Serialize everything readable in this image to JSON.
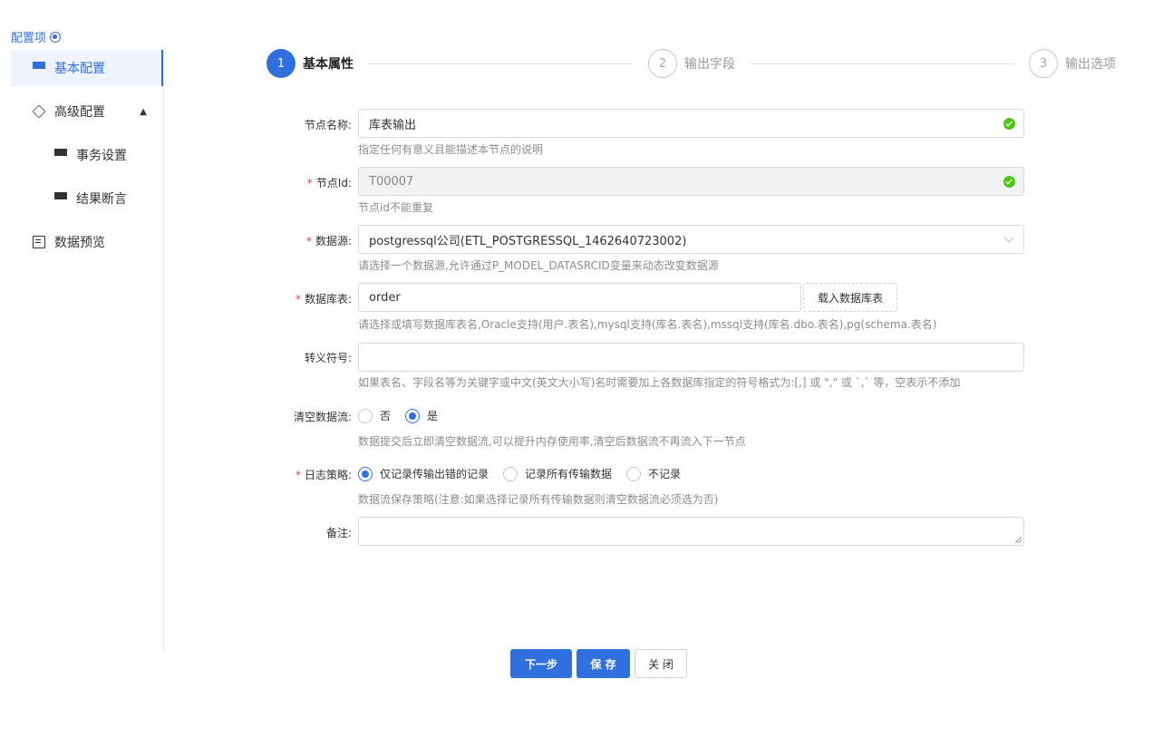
{
  "sidebar": {
    "title": "配置项",
    "items": [
      {
        "label": "基本配置",
        "icon": "grid-icon",
        "active": true
      },
      {
        "label": "高级配置",
        "icon": "cube-icon",
        "expanded": true
      },
      {
        "label": "事务设置",
        "icon": "grid-icon"
      },
      {
        "label": "结果断言",
        "icon": "grid-icon"
      },
      {
        "label": "数据预览",
        "icon": "document-icon"
      }
    ]
  },
  "steps": [
    {
      "number": "1",
      "label": "基本属性",
      "state": "active"
    },
    {
      "number": "2",
      "label": "输出字段",
      "state": "inactive"
    },
    {
      "number": "3",
      "label": "输出选项",
      "state": "inactive"
    }
  ],
  "form": {
    "node_name": {
      "label": "节点名称:",
      "value": "库表输出",
      "help": "指定任何有意义且能描述本节点的说明"
    },
    "node_id": {
      "label": "节点Id:",
      "value": "T00007",
      "help": "节点id不能重复"
    },
    "datasource": {
      "label": "数据源:",
      "value": "postgressql公司(ETL_POSTGRESSQL_1462640723002)",
      "help": "请选择一个数据源,允许通过P_MODEL_DATASRCID变量来动态改变数据源"
    },
    "table": {
      "label": "数据库表:",
      "value": "order",
      "button": "载入数据库表",
      "help": "请选择或填写数据库表名,Oracle支持(用户.表名),mysql支持(库名.表名),mssql支持(库名.dbo.表名),pg(schema.表名)"
    },
    "escape": {
      "label": "转义符号:",
      "value": "",
      "help": "如果表名、字段名等为关键字或中文(英文大小写)名时需要加上各数据库指定的符号格式为:[,] 或 \",\" 或 `,` 等，空表示不添加"
    },
    "clear_stream": {
      "label": "清空数据流:",
      "options": [
        "否",
        "是"
      ],
      "selected": "是",
      "help": "数据提交后立即清空数据流,可以提升内存使用率,清空后数据流不再流入下一节点"
    },
    "log_policy": {
      "label": "日志策略:",
      "options": [
        "仅记录传输出错的记录",
        "记录所有传输数据",
        "不记录"
      ],
      "selected": "仅记录传输出错的记录",
      "help": "数据流保存策略(注意:如果选择记录所有传输数据则清空数据流必须选为否)"
    },
    "remark": {
      "label": "备注:",
      "value": ""
    },
    "required_mark": "*"
  },
  "buttons": {
    "next": "下一步",
    "save": "保 存",
    "close": "关 闭"
  },
  "colors": {
    "accent": "#2f6fe0",
    "success": "#52c41a",
    "required": "#e0403a"
  }
}
